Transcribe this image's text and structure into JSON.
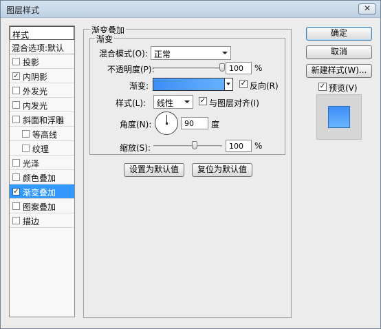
{
  "window": {
    "title": "图层样式",
    "close_glyph": "✕"
  },
  "sidebar": {
    "header": "样式",
    "items": [
      {
        "label": "混合选项:默认",
        "checkbox": false,
        "checked": false
      },
      {
        "label": "投影",
        "checkbox": true,
        "checked": false
      },
      {
        "label": "内阴影",
        "checkbox": true,
        "checked": true
      },
      {
        "label": "外发光",
        "checkbox": true,
        "checked": false
      },
      {
        "label": "内发光",
        "checkbox": true,
        "checked": false
      },
      {
        "label": "斜面和浮雕",
        "checkbox": true,
        "checked": false
      },
      {
        "label": "等高线",
        "checkbox": true,
        "checked": false,
        "sub": true
      },
      {
        "label": "纹理",
        "checkbox": true,
        "checked": false,
        "sub": true
      },
      {
        "label": "光泽",
        "checkbox": true,
        "checked": false
      },
      {
        "label": "颜色叠加",
        "checkbox": true,
        "checked": false
      },
      {
        "label": "渐变叠加",
        "checkbox": true,
        "checked": true,
        "selected": true
      },
      {
        "label": "图案叠加",
        "checkbox": true,
        "checked": false
      },
      {
        "label": "描边",
        "checkbox": true,
        "checked": false
      }
    ]
  },
  "panel": {
    "title": "渐变叠加",
    "group_title": "渐变",
    "blend_mode_label": "混合模式(O):",
    "blend_mode_value": "正常",
    "opacity_label": "不透明度(P):",
    "opacity_value": "100",
    "opacity_unit": "%",
    "opacity_fraction": 1.0,
    "gradient_label": "渐变:",
    "reverse_label": "反向(R)",
    "reverse_checked": true,
    "style_label": "样式(L):",
    "style_value": "线性",
    "align_label": "与图层对齐(I)",
    "align_checked": true,
    "angle_label": "角度(N):",
    "angle_value": "90",
    "angle_unit": "度",
    "scale_label": "缩放(S):",
    "scale_value": "100",
    "scale_unit": "%",
    "scale_fraction": 0.6,
    "make_default_label": "设置为默认值",
    "reset_default_label": "复位为默认值"
  },
  "buttons": {
    "ok": "确定",
    "cancel": "取消",
    "new_style": "新建样式(W)...",
    "preview_label": "预览(V)",
    "preview_checked": true
  },
  "colors": {
    "selection": "#3399ff",
    "gradient_start": "#3d8ef7",
    "gradient_end": "#6ab5ff"
  },
  "check_glyph": "✓"
}
